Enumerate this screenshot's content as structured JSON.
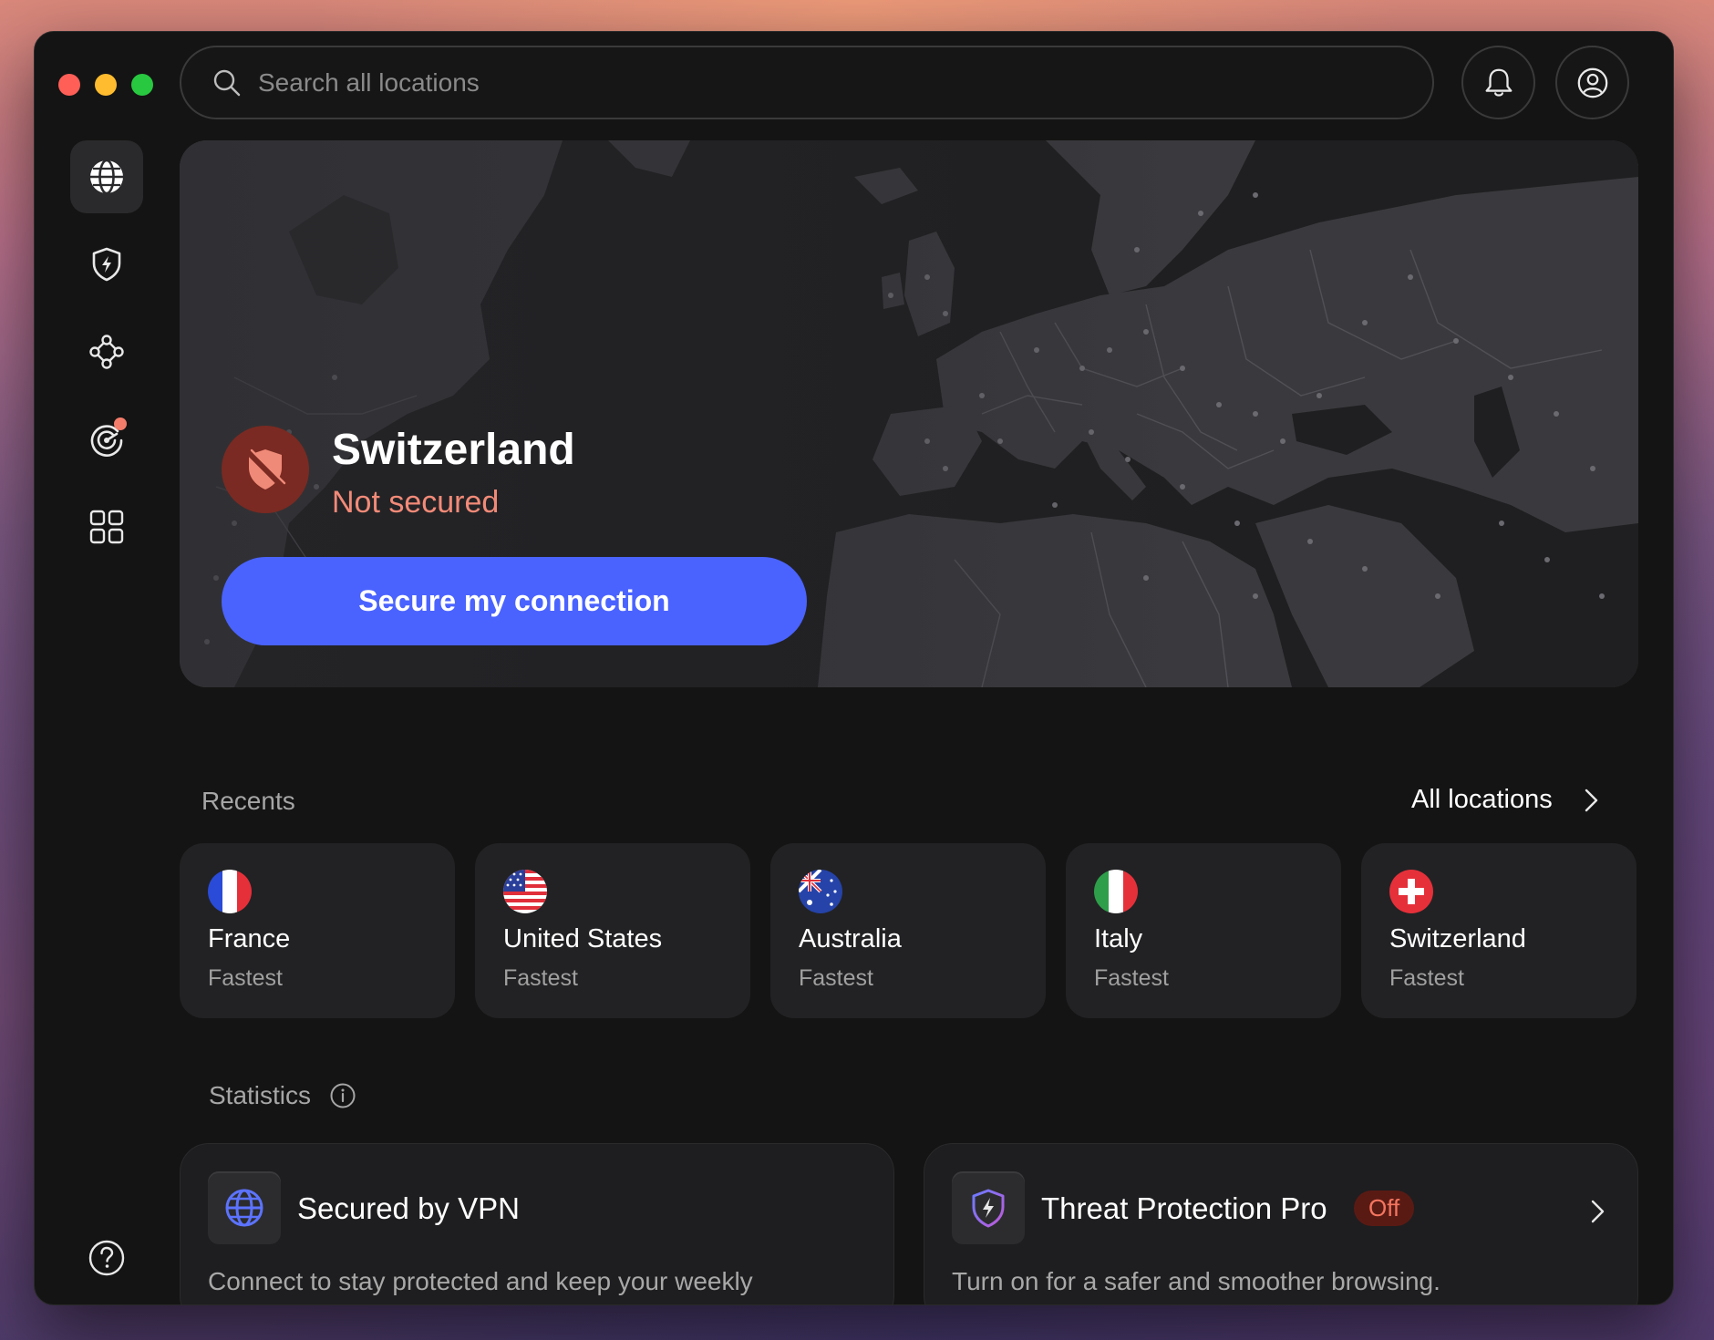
{
  "search": {
    "placeholder": "Search all locations"
  },
  "hero": {
    "country": "Switzerland",
    "status": "Not secured",
    "connect_label": "Secure my connection"
  },
  "recents": {
    "label": "Recents",
    "all_locations_label": "All locations",
    "items": [
      {
        "name": "France",
        "sub": "Fastest",
        "flag": "france-flag-icon"
      },
      {
        "name": "United States",
        "sub": "Fastest",
        "flag": "us-flag-icon"
      },
      {
        "name": "Australia",
        "sub": "Fastest",
        "flag": "australia-flag-icon"
      },
      {
        "name": "Italy",
        "sub": "Fastest",
        "flag": "italy-flag-icon"
      },
      {
        "name": "Switzerland",
        "sub": "Fastest",
        "flag": "switzerland-flag-icon"
      }
    ]
  },
  "statistics": {
    "label": "Statistics",
    "vpn_card": {
      "title": "Secured by VPN",
      "desc": "Connect to stay protected and keep your weekly"
    },
    "threat_card": {
      "title": "Threat Protection Pro",
      "badge": "Off",
      "desc": "Turn on for a safer and smoother browsing."
    }
  },
  "sidebar": {
    "items": [
      "globe-icon",
      "shield-bolt-icon",
      "mesh-network-icon",
      "dark-web-monitor-icon",
      "apps-grid-icon"
    ],
    "help": "help-icon"
  },
  "colors": {
    "accent": "#4a63ff",
    "danger": "#f28a78",
    "window_bg": "#141414",
    "card_bg": "#222224"
  }
}
